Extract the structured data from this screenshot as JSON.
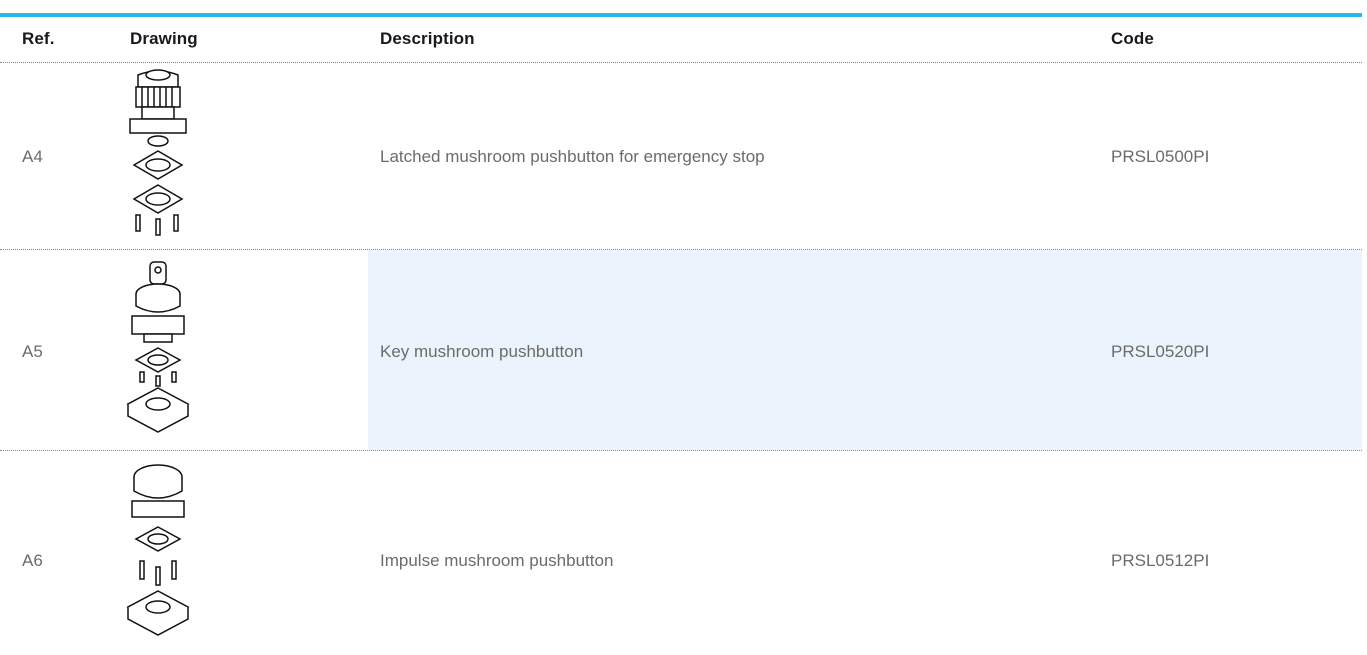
{
  "header": {
    "ref": "Ref.",
    "drawing": "Drawing",
    "description": "Description",
    "code": "Code"
  },
  "rows": [
    {
      "ref": "A4",
      "description": "Latched mushroom pushbutton for emergency stop",
      "code": "PRSL0500PI",
      "drawing_icon": "latched-pushbutton-exploded-drawing",
      "highlighted": false
    },
    {
      "ref": "A5",
      "description": "Key mushroom pushbutton",
      "code": "PRSL0520PI",
      "drawing_icon": "key-pushbutton-exploded-drawing",
      "highlighted": true
    },
    {
      "ref": "A6",
      "description": "Impulse mushroom pushbutton",
      "code": "PRSL0512PI",
      "drawing_icon": "impulse-pushbutton-exploded-drawing",
      "highlighted": false
    }
  ],
  "colors": {
    "accent": "#2bb6e8",
    "highlight": "#ebf4fc",
    "text": "#6b6b6b",
    "header_text": "#1a1a1a"
  }
}
